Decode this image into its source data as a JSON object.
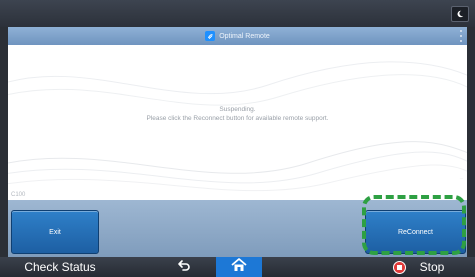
{
  "header": {
    "title": "Optimal Remote"
  },
  "main": {
    "message_line1": "Suspending.",
    "message_line2": "Please click the Reconnect button for available remote support.",
    "corner_label": "C100",
    "corner_code": "…"
  },
  "actions": {
    "exit_label": "Exit",
    "reconnect_label": "ReConnect"
  },
  "bottom": {
    "check_status_label": "Check Status",
    "stop_label": "Stop"
  },
  "icons": {
    "top_right": "moon-icon",
    "app": "optimal-remote-app-icon",
    "menu": "kebab-menu-icon",
    "back": "back-arrow-icon",
    "home": "home-icon",
    "stop": "stop-icon"
  },
  "colors": {
    "accent_blue": "#1d78d6",
    "button_blue": "#2f80c9",
    "highlight_green": "#2ea043",
    "stop_red": "#e03a3a"
  }
}
